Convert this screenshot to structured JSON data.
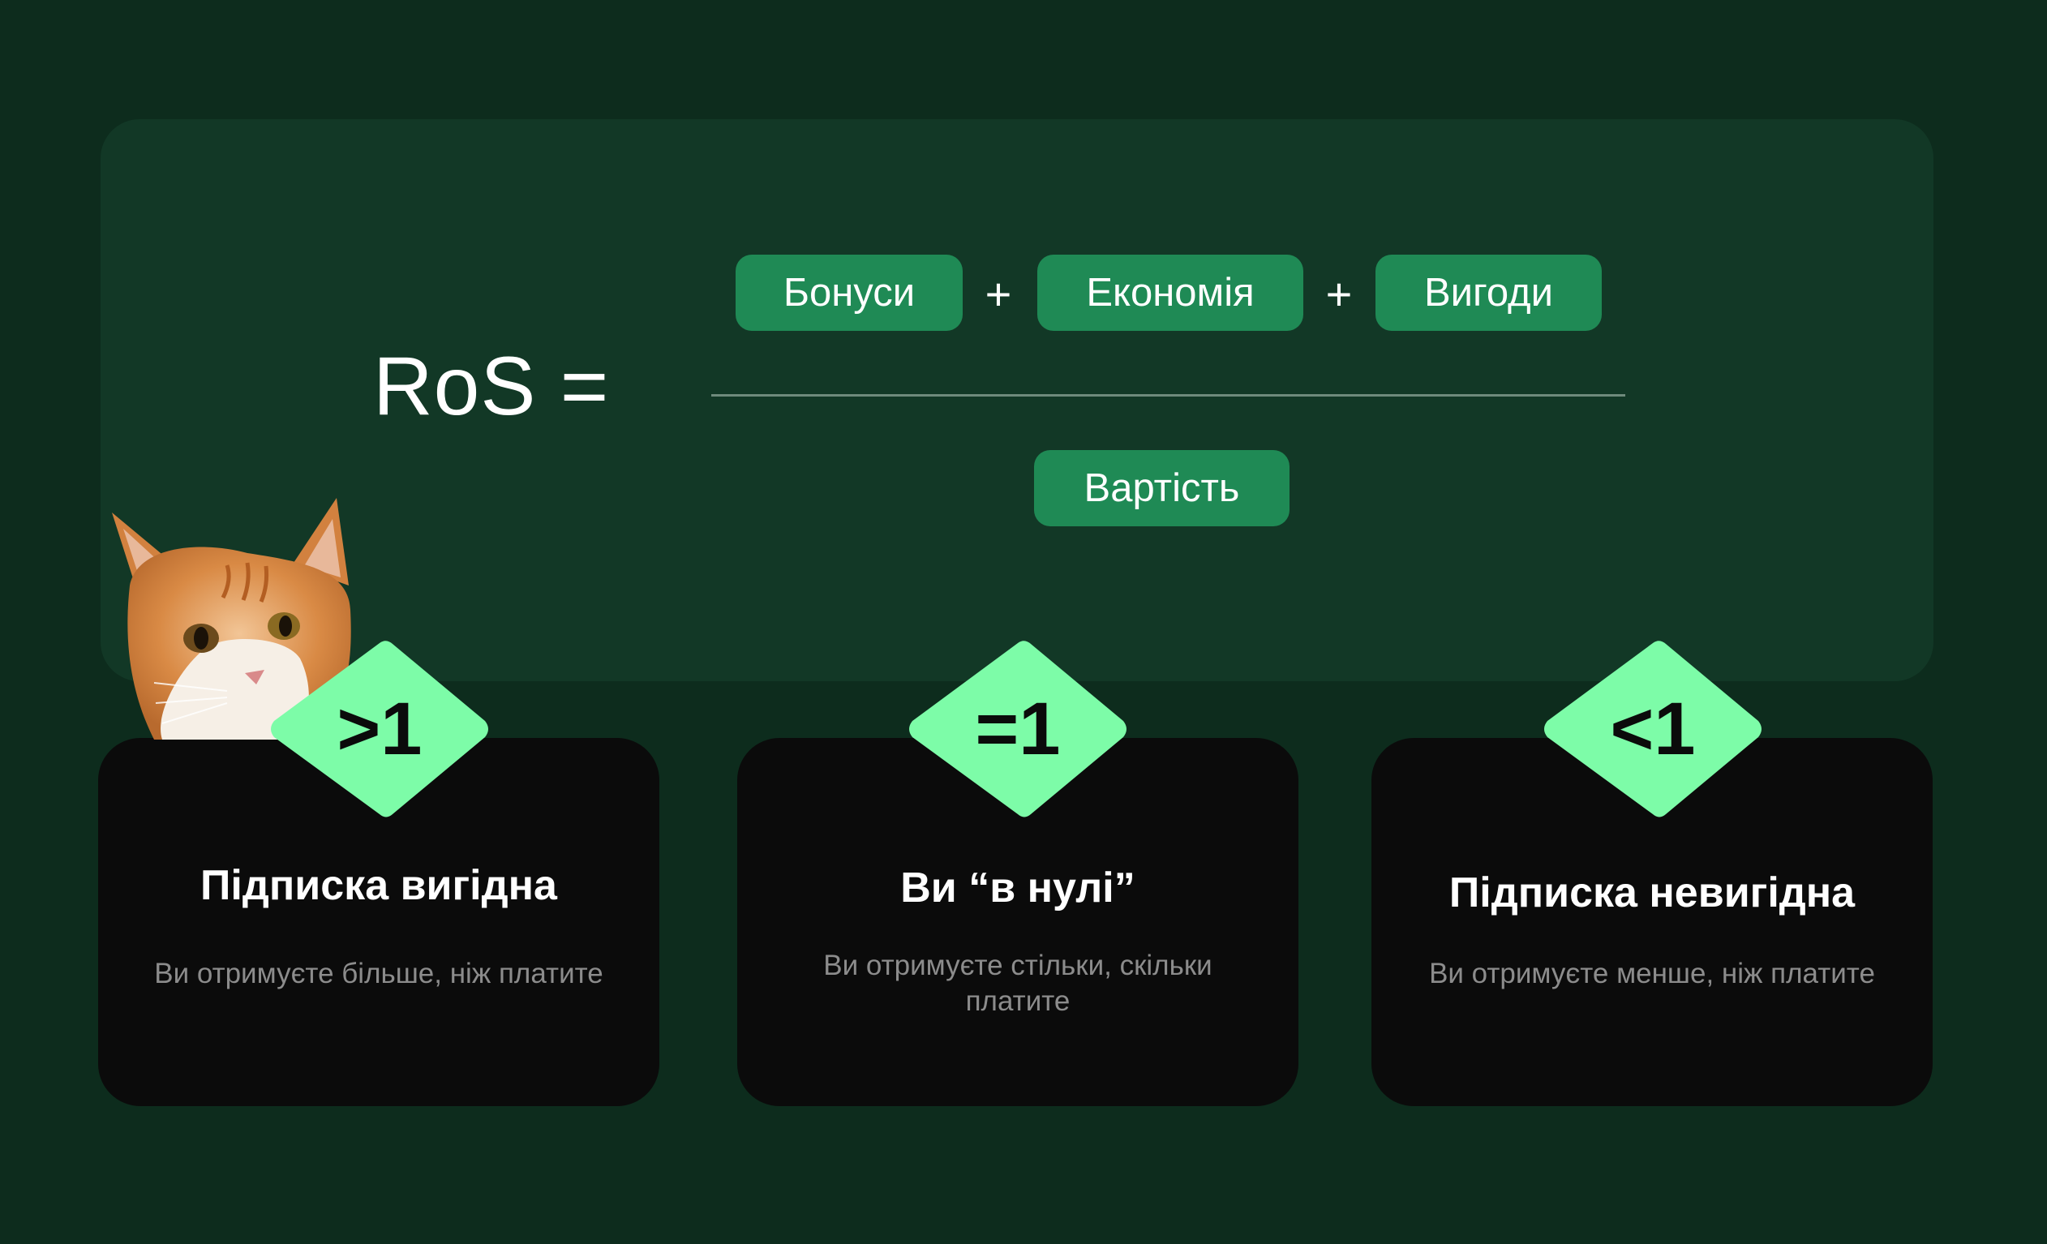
{
  "formula": {
    "lhs": "RoS =",
    "numerator": [
      "Бонуси",
      "Економія",
      "Вигоди"
    ],
    "operator": "+",
    "denominator": "Вартість"
  },
  "cards": [
    {
      "badge": ">1",
      "title": "Підписка вигідна",
      "description": "Ви отримуєте більше, ніж платите"
    },
    {
      "badge": "=1",
      "title": "Ви “в нулі”",
      "description": "Ви отримуєте стільки, скільки платите"
    },
    {
      "badge": "<1",
      "title": "Підписка невигідна",
      "description": "Ви отримуєте менше, ніж платите"
    }
  ],
  "colors": {
    "background": "#0d2c1d",
    "panel": "#123826",
    "pill": "#1f8a55",
    "badge": "#7dfca8",
    "card": "#0b0b0b"
  },
  "decoration": {
    "cat_image": "ginger-cat"
  }
}
